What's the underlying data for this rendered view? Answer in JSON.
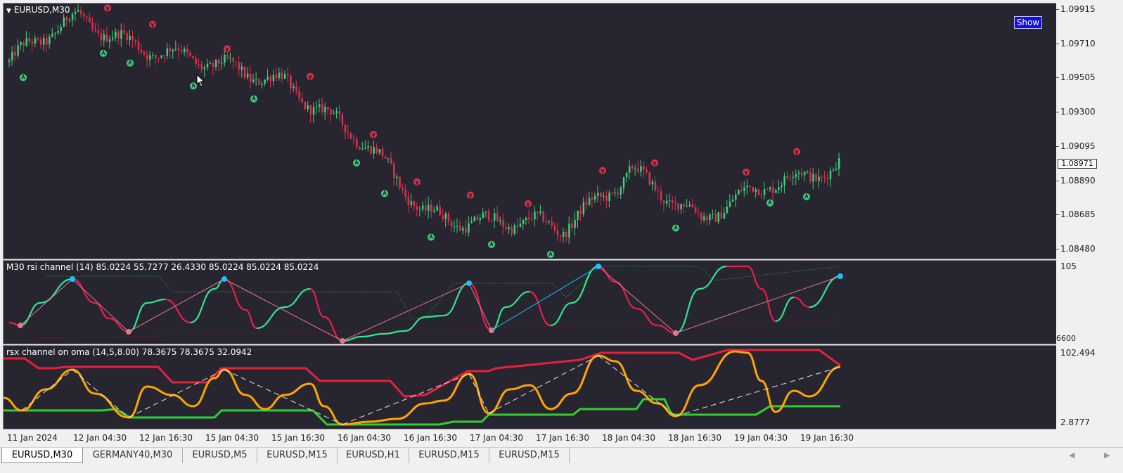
{
  "main_pane": {
    "title": "EURUSD,M30",
    "show_button": "Show",
    "price_ticks": [
      "1.09915",
      "1.09710",
      "1.09505",
      "1.09300",
      "1.09095",
      "1.08890",
      "1.08685",
      "1.08480"
    ],
    "current_price": "1.08971",
    "colors": {
      "bull": "#3cd07a",
      "bear": "#e0304a",
      "background": "#272530"
    }
  },
  "rsi_pane": {
    "title": "M30 rsi channel (14) 85.0224 55.7277 26.4330 85.0224 85.0224 85.0224",
    "scale_top": "105",
    "scale_bottom": "6600",
    "colors": {
      "up": "#2ee88e",
      "down": "#e8204a",
      "peak": "#1ec0ff",
      "trough": "#e07890"
    }
  },
  "rsx_pane": {
    "title": "rsx channel on oma (14,5,8.00) 78.3675 78.3675 32.0942",
    "scale_top": "102.494",
    "scale_bottom": "2.8777",
    "colors": {
      "upper": "#e8203c",
      "signal": "#ffa500",
      "lower": "#30d030"
    }
  },
  "time_axis": [
    "11 Jan 2024",
    "12 Jan 04:30",
    "12 Jan 16:30",
    "15 Jan 04:30",
    "15 Jan 16:30",
    "16 Jan 04:30",
    "16 Jan 16:30",
    "17 Jan 04:30",
    "17 Jan 16:30",
    "18 Jan 04:30",
    "18 Jan 16:30",
    "19 Jan 04:30",
    "19 Jan 16:30"
  ],
  "tabs": [
    "EURUSD,M30",
    "GERMANY40,M30",
    "EURUSD,M5",
    "EURUSD,M15",
    "EURUSD,H1",
    "EURUSD,M15",
    "EURUSD,M15"
  ],
  "active_tab": 0,
  "chart_data": {
    "type": "line",
    "title": "EURUSD,M30",
    "x": [
      "11 Jan 2024",
      "12 Jan 04:30",
      "12 Jan 16:30",
      "15 Jan 04:30",
      "15 Jan 16:30",
      "16 Jan 04:30",
      "16 Jan 16:30",
      "17 Jan 04:30",
      "17 Jan 16:30",
      "18 Jan 04:30",
      "18 Jan 16:30",
      "19 Jan 04:30",
      "19 Jan 16:30"
    ],
    "series": [
      {
        "values": [
          1.096,
          1.0985,
          1.097,
          1.0955,
          1.095,
          1.0915,
          1.087,
          1.0865,
          1.0858,
          1.0898,
          1.0862,
          1.089,
          1.0897
        ]
      }
    ],
    "ylim": [
      1.0845,
      1.0995
    ]
  }
}
